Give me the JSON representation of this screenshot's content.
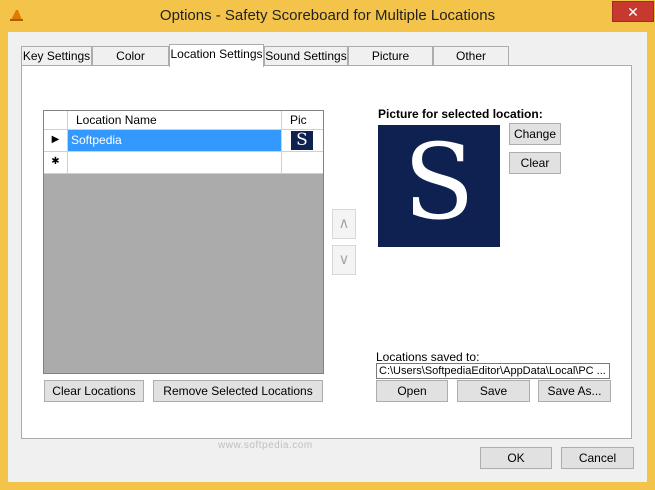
{
  "window": {
    "title": "Options - Safety Scoreboard for Multiple Locations",
    "close_label": "✕"
  },
  "tabs": [
    {
      "label": "Key Settings",
      "active": false
    },
    {
      "label": "Color Settings",
      "active": false
    },
    {
      "label": "Location Settings",
      "active": true
    },
    {
      "label": "Sound Settings",
      "active": false
    },
    {
      "label": "Picture Settings",
      "active": false
    },
    {
      "label": "Other Settings",
      "active": false
    }
  ],
  "grid": {
    "columns": [
      "Location Name",
      "Pic"
    ],
    "rows": [
      {
        "indicator": "▶",
        "name": "Softpedia",
        "pic_letter": "S",
        "selected": true
      },
      {
        "indicator": "✱",
        "name": "",
        "pic_letter": "",
        "selected": false
      }
    ]
  },
  "arrows": {
    "up": "∧",
    "down": "∨"
  },
  "picture": {
    "label": "Picture for selected location:",
    "letter": "S",
    "change_label": "Change",
    "clear_label": "Clear"
  },
  "locations": {
    "clear_label": "Clear Locations",
    "remove_label": "Remove Selected Locations",
    "saved_label": "Locations saved to:",
    "path": "C:\\Users\\SoftpediaEditor\\AppData\\Local\\PC ...",
    "open_label": "Open",
    "save_label": "Save",
    "save_as_label": "Save As..."
  },
  "dialog": {
    "ok_label": "OK",
    "cancel_label": "Cancel"
  },
  "watermark": "www.softpedia.com",
  "colors": {
    "frame": "#f4c44a",
    "selection": "#3399ff",
    "picture_bg": "#0e2150",
    "close": "#c7392e"
  }
}
